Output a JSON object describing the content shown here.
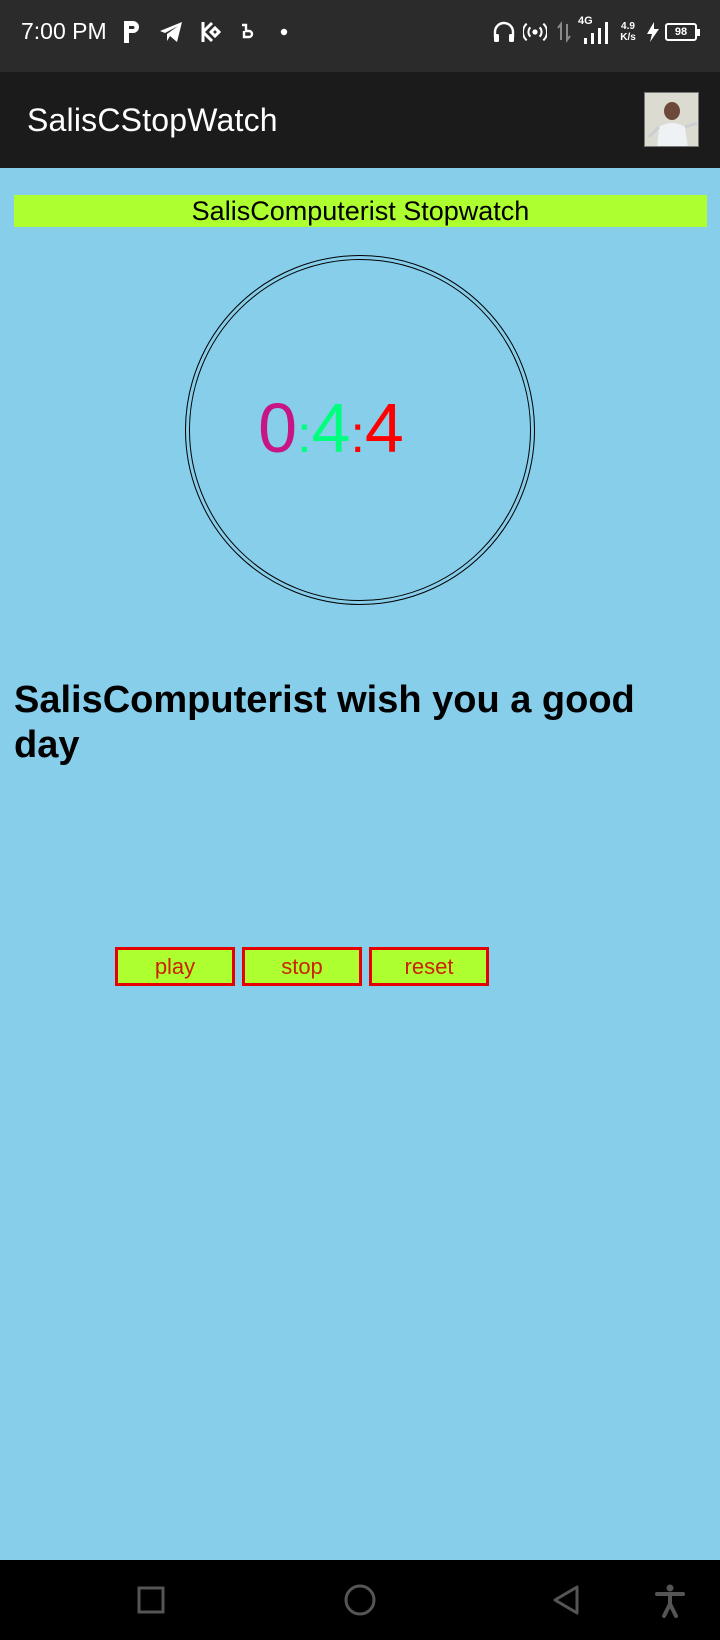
{
  "status_bar": {
    "time": "7:00 PM",
    "network_type": "4G",
    "speed_value": "4.9",
    "speed_unit": "K/s",
    "battery": "98",
    "icons": [
      "p-app-icon",
      "telegram-icon",
      "kucoin-icon",
      "app-icon",
      "dot-icon",
      "headphones-icon",
      "hotspot-icon",
      "data-arrows-icon",
      "signal-icon",
      "charging-icon",
      "battery-icon"
    ]
  },
  "app_bar": {
    "title": "SalisCStopWatch"
  },
  "main": {
    "banner_title": "SalisComputerist Stopwatch",
    "time": {
      "hours": "0",
      "sep1": ":",
      "minutes": "4",
      "sep2": ":",
      "seconds": "4"
    },
    "greeting": "SalisComputerist wish you a good day",
    "buttons": {
      "play": "play",
      "stop": "stop",
      "reset": "reset"
    }
  },
  "colors": {
    "content_bg": "#87ceeb",
    "banner_bg": "#adff2f",
    "hours": "#c71585",
    "minutes": "#00ff7f",
    "seconds": "#ff0000",
    "button_border": "#e60000"
  },
  "nav_bar": {
    "icons": [
      "recents-icon",
      "home-icon",
      "back-icon",
      "accessibility-icon"
    ]
  }
}
